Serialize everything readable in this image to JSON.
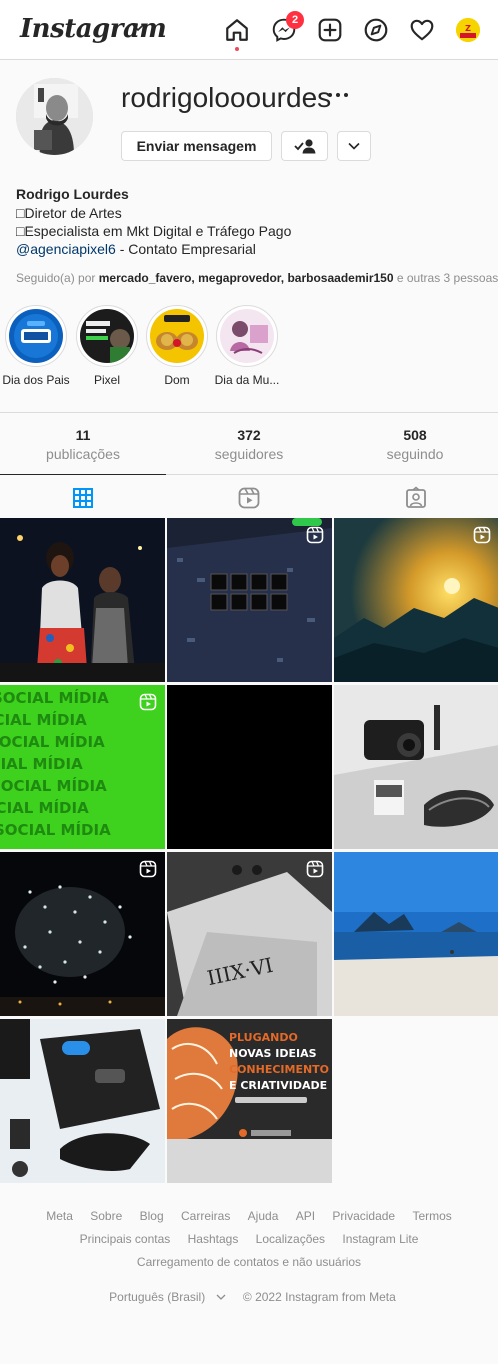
{
  "topbar": {
    "logo": "Instagram",
    "messages_badge": "2",
    "icons": [
      "home-icon",
      "messenger-icon",
      "new-post-icon",
      "explore-icon",
      "activity-heart-icon",
      "profile-avatar-icon"
    ]
  },
  "profile": {
    "username": "rodrigolooourdes",
    "message_button": "Enviar mensagem",
    "full_name": "Rodrigo Lourdes",
    "bio_line1": "□Diretor de Artes",
    "bio_line2": "□Especialista em Mkt Digital e Tráfego Pago",
    "bio_link": "@agenciapixel6",
    "bio_link_rest": " - Contato Empresarial",
    "followed_prefix": "Seguido(a) por ",
    "followed_users": "mercado_favero, megaprovedor, barbosaademir150",
    "followed_suffix": " e outras 3 pessoas"
  },
  "highlights": [
    {
      "label": "Dia dos Pais"
    },
    {
      "label": "Pixel"
    },
    {
      "label": "Dom"
    },
    {
      "label": "Dia da Mu..."
    }
  ],
  "stats": {
    "posts_count": "11",
    "posts_label": "publicações",
    "followers_count": "372",
    "followers_label": "seguidores",
    "following_count": "508",
    "following_label": "seguindo"
  },
  "tabs": [
    "grid-icon",
    "reels-icon",
    "tagged-icon"
  ],
  "posts": [
    {
      "alt": "couple photo",
      "reel": false
    },
    {
      "alt": "keyboard city",
      "reel": true
    },
    {
      "alt": "sunset landscape",
      "reel": true
    },
    {
      "alt": "social midia green",
      "reel": true,
      "text": "SOCIAL MÍDIA"
    },
    {
      "alt": "black",
      "reel": false
    },
    {
      "alt": "camera gear",
      "reel": false
    },
    {
      "alt": "fireworks",
      "reel": true
    },
    {
      "alt": "tattoo",
      "reel": true
    },
    {
      "alt": "beach",
      "reel": false
    },
    {
      "alt": "gimbal",
      "reel": false
    },
    {
      "alt": "plugando",
      "reel": false,
      "text_lines": [
        "PLUGANDO",
        "NOVAS IDEIAS",
        "CONHECIMENTO",
        "E CRIATIVIDADE"
      ]
    }
  ],
  "footer": {
    "row1": [
      "Meta",
      "Sobre",
      "Blog",
      "Carreiras",
      "Ajuda",
      "API",
      "Privacidade",
      "Termos"
    ],
    "row2": [
      "Principais contas",
      "Hashtags",
      "Localizações",
      "Instagram Lite"
    ],
    "row3": "Carregamento de contatos e não usuários",
    "language": "Português (Brasil)",
    "copyright": "© 2022 Instagram from Meta"
  }
}
